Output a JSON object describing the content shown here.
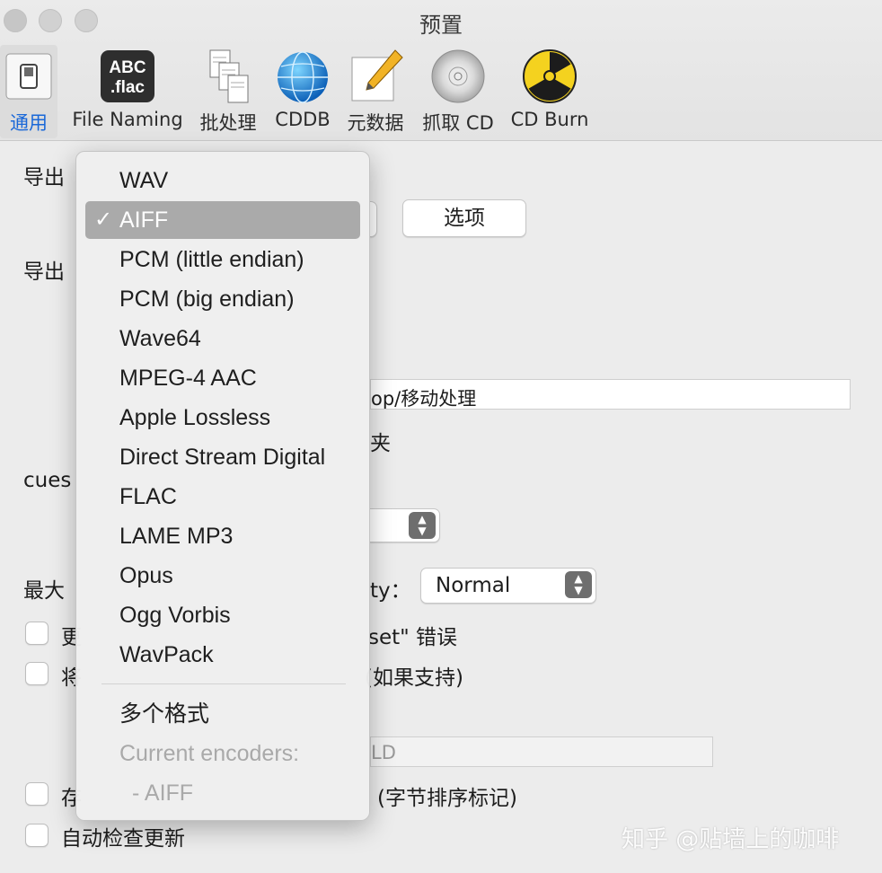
{
  "window": {
    "title": "预置"
  },
  "toolbar": {
    "items": [
      {
        "label": "通用",
        "icon": "switch-icon"
      },
      {
        "label": "File Naming",
        "icon": "abc-flac-icon",
        "icon_text_1": "ABC",
        "icon_text_2": ".flac"
      },
      {
        "label": "批处理",
        "icon": "documents-icon"
      },
      {
        "label": "CDDB",
        "icon": "globe-icon"
      },
      {
        "label": "元数据",
        "icon": "pencil-note-icon"
      },
      {
        "label": "抓取 CD",
        "icon": "cd-icon"
      },
      {
        "label": "CD Burn",
        "icon": "radiation-icon"
      }
    ],
    "selected_index": 0
  },
  "background": {
    "export_format_label": "导出",
    "options_button": "选项",
    "export_folder_label": "导出",
    "path_value": "op/移动处理",
    "folder_text": "夹",
    "cue_label": "cues",
    "max_label": "最大",
    "priority_label": "ty：",
    "priority_value": "Normal",
    "checkbox1_label_left": "更",
    "checkbox1_label_right": "set\" 错误",
    "checkbox2_label_left": "将",
    "checkbox2_label_right": "(如果支持)",
    "disabled_field_value": "LD",
    "checkbox3_label_left": "存",
    "checkbox3_label_right": "(字节排序标记)",
    "auto_update_label": "自动检查更新"
  },
  "format_menu": {
    "items": [
      {
        "label": "WAV",
        "checked": false
      },
      {
        "label": "AIFF",
        "checked": true
      },
      {
        "label": "PCM (little endian)",
        "checked": false
      },
      {
        "label": "PCM (big endian)",
        "checked": false
      },
      {
        "label": "Wave64",
        "checked": false
      },
      {
        "label": "MPEG-4 AAC",
        "checked": false
      },
      {
        "label": "Apple Lossless",
        "checked": false
      },
      {
        "label": "Direct Stream Digital",
        "checked": false
      },
      {
        "label": "FLAC",
        "checked": false
      },
      {
        "label": "LAME MP3",
        "checked": false
      },
      {
        "label": "Opus",
        "checked": false
      },
      {
        "label": "Ogg Vorbis",
        "checked": false
      },
      {
        "label": "WavPack",
        "checked": false
      }
    ],
    "check_glyph": "✓",
    "multiple_formats": "多个格式",
    "current_encoders_label": "Current encoders:",
    "current_encoder_value": "- AIFF"
  },
  "watermark": "知乎 @贴墙上的咖啡",
  "colors": {
    "accent": "#1a68d8",
    "selected_item_bg": "#aaaaaa"
  }
}
